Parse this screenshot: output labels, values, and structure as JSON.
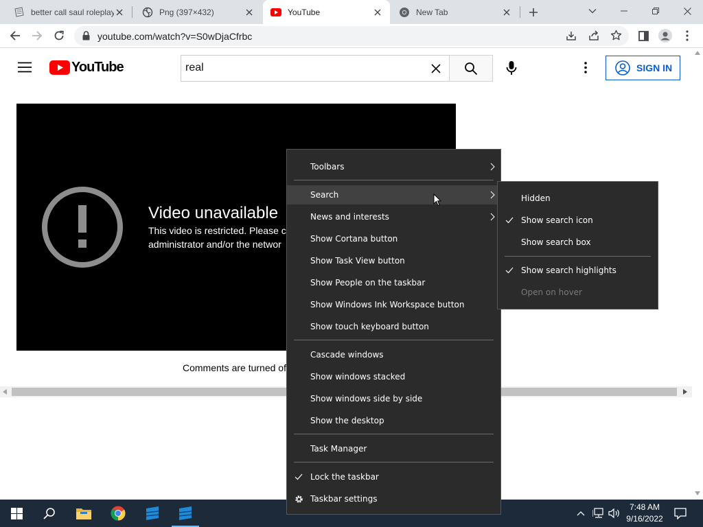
{
  "browser": {
    "tabs": [
      {
        "title": "better call saul roleplay",
        "favicon": "doc-icon"
      },
      {
        "title": "Png (397×432)",
        "favicon": "globe-icon"
      },
      {
        "title": "YouTube",
        "favicon": "youtube-icon",
        "active": true
      },
      {
        "title": "New Tab",
        "favicon": "chrome-icon"
      }
    ],
    "new_tab_icon": "plus-icon",
    "url": "youtube.com/watch?v=S0wDjaCfrbc"
  },
  "youtube": {
    "logo_text": "YouTube",
    "search_value": "real",
    "sign_in_label": "SIGN IN",
    "accent": "#ff0000"
  },
  "player": {
    "title": "Video unavailable",
    "message_line1": "This video is restricted. Please c",
    "message_line2": "administrator and/or the networ"
  },
  "comments_text": "Comments are turned of",
  "context_menu": {
    "items": [
      {
        "label": "Toolbars",
        "submenu": true
      },
      {
        "label": "Search",
        "submenu": true,
        "highlighted": true
      },
      {
        "label": "News and interests",
        "submenu": true
      },
      {
        "label": "Show Cortana button"
      },
      {
        "label": "Show Task View button"
      },
      {
        "label": "Show People on the taskbar"
      },
      {
        "label": "Show Windows Ink Workspace button"
      },
      {
        "label": "Show touch keyboard button"
      },
      {
        "label": "Cascade windows"
      },
      {
        "label": "Show windows stacked"
      },
      {
        "label": "Show windows side by side"
      },
      {
        "label": "Show the desktop"
      },
      {
        "label": "Task Manager"
      },
      {
        "label": "Lock the taskbar",
        "checked": true
      },
      {
        "label": "Taskbar settings",
        "icon": "gear-icon"
      }
    ]
  },
  "search_submenu": {
    "items": [
      {
        "label": "Hidden"
      },
      {
        "label": "Show search icon",
        "checked": true
      },
      {
        "label": "Show search box"
      },
      {
        "label": "Show search highlights",
        "checked": true
      },
      {
        "label": "Open on hover",
        "disabled": true
      }
    ]
  },
  "taskbar": {
    "time": "7:48 AM",
    "date": "9/16/2022",
    "pinned": [
      "windows-start-icon",
      "search-icon",
      "file-explorer-icon",
      "chrome-icon",
      "app-icon",
      "app-icon-active"
    ]
  }
}
